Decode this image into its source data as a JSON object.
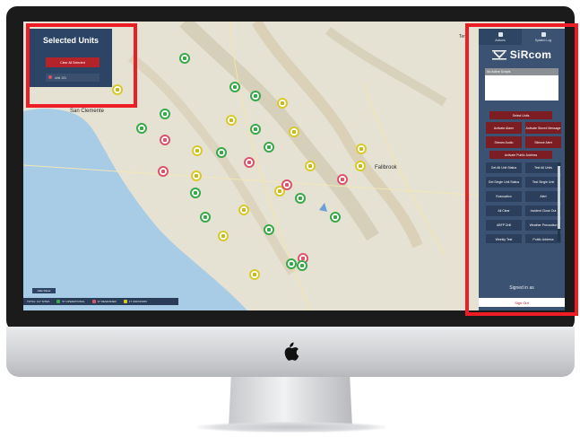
{
  "selected_panel": {
    "title": "Selected Units",
    "clear_label": "Clear All Selected",
    "item_label": "Unit 131"
  },
  "map": {
    "labels": {
      "san_clemente": "San Clemente",
      "fallbrook": "Fallbrook",
      "top_right": "Tem"
    }
  },
  "legend": {
    "button_label": "Hide Panel",
    "total": "TOTAL: 117 SITES",
    "operational": "57 OPERATIONAL",
    "degraded": "17 DEGRADED",
    "unknown": "17 UNKNOWN",
    "colors": {
      "operational": "#38a848",
      "degraded": "#d9546a",
      "unknown": "#d9c92a"
    }
  },
  "sidebar": {
    "tabs": [
      {
        "label": "Actions",
        "icon": "home-icon"
      },
      {
        "label": "System Log",
        "icon": "calendar-icon"
      }
    ],
    "logo": "SiRcom",
    "script_header": "No Active Scripts",
    "buttons": {
      "select_units": "Select Units",
      "activate_alarm": "Activate Alarm",
      "activate_stored_message": "Activate Stored Message",
      "stream_audio": "Stream Audio",
      "silence_alert": "Silence Alert",
      "activate_pa": "Activate Public Address"
    },
    "list": [
      "Get All Unit Status",
      "Test All Units",
      "Get Single Unit Status",
      "Test Single Unit",
      "Evacuation",
      "Alert",
      "All Clear",
      "Incident Close Out",
      "ABFP Drill",
      "Weather Precaution",
      "Weekly Test",
      "Public Address"
    ],
    "signed_in": "Signed in as",
    "sign_out": "Sign Out"
  }
}
